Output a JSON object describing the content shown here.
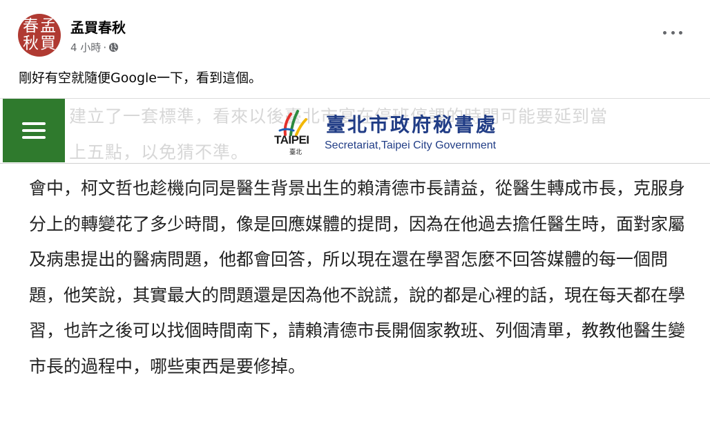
{
  "post": {
    "author": "孟買春秋",
    "avatar_chars": [
      "春",
      "孟",
      "秋",
      "買"
    ],
    "time": "4 小時",
    "separator": "·",
    "audience_icon": "globe-icon",
    "more_icon": "more-options-icon",
    "caption": "剛好有空就隨便Google一下，看到這個。"
  },
  "screenshot": {
    "bg_line_1": "建立了一套標準，看來以後臺北市宴在停班停課的時間可能要延到當",
    "bg_line_2": "上五點，以免猜不準。",
    "menu_icon": "hamburger-menu-icon",
    "logo_word": "TAIPEI",
    "logo_sub": "臺北",
    "office_zh": "臺北市政府秘書處",
    "office_en": "Secretariat,Taipei City Government",
    "body": "會中，柯文哲也趁機向同是醫生背景出生的賴清德市長請益，從醫生轉成市長，克服身分上的轉變花了多少時間，像是回應媒體的提問，因為在他過去擔任醫生時，面對家屬及病患提出的醫病問題，他都會回答，所以現在還在學習怎麼不回答媒體的每一個問題，他笑說，其實最大的問題還是因為他不說謊，說的都是心裡的話，現在每天都在學習，也許之後可以找個時間南下，請賴清德市長開個家教班、列個清單，教教他醫生變市長的過程中，哪些東西是要修掉。"
  },
  "colors": {
    "menu_green": "#2f7a2d",
    "office_blue": "#213d86",
    "seal_red": "#b03a32"
  }
}
